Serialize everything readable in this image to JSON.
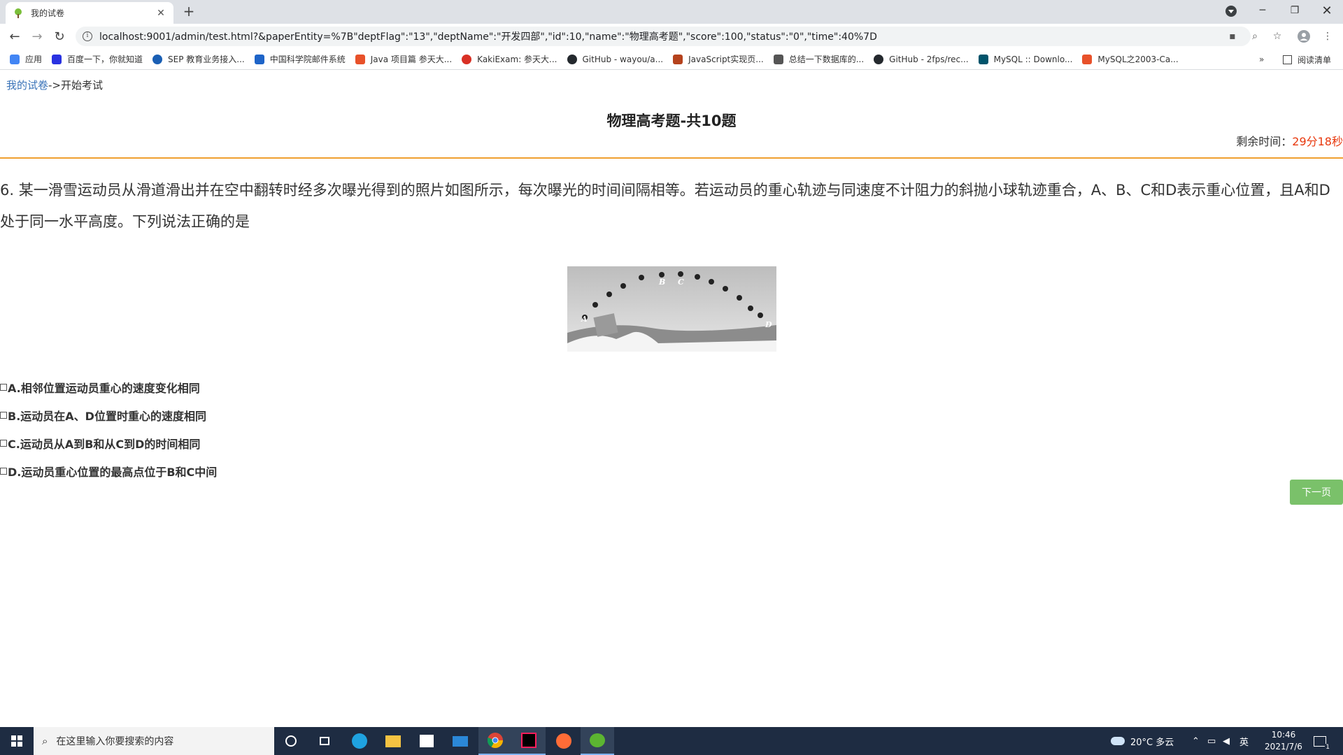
{
  "browser": {
    "tab_title": "我的试卷",
    "url": "localhost:9001/admin/test.html?&paperEntity=%7B\"deptFlag\":\"13\",\"deptName\":\"开发四部\",\"id\":10,\"name\":\"物理高考题\",\"score\":100,\"status\":\"0\",\"time\":40%7D",
    "bookmarks": [
      {
        "label": "应用",
        "color": "#4285f4"
      },
      {
        "label": "百度一下，你就知道",
        "color": "#2932e1"
      },
      {
        "label": "SEP 教育业务接入...",
        "color": "#1a5fb4"
      },
      {
        "label": "中国科学院邮件系统",
        "color": "#1e64c8"
      },
      {
        "label": "Java 项目篇 参天大...",
        "color": "#e8512a"
      },
      {
        "label": "KakiExam: 参天大...",
        "color": "#d93025"
      },
      {
        "label": "GitHub - wayou/a...",
        "color": "#24292e"
      },
      {
        "label": "JavaScript实现页...",
        "color": "#b5421d"
      },
      {
        "label": "总结一下数据库的...",
        "color": "#555555"
      },
      {
        "label": "GitHub - 2fps/rec...",
        "color": "#24292e"
      },
      {
        "label": "MySQL :: Downlo...",
        "color": "#00546b"
      },
      {
        "label": "MySQL之2003-Ca...",
        "color": "#e8512a"
      }
    ],
    "bookmarks_more": "»",
    "reading_list": "阅读清单"
  },
  "page": {
    "breadcrumb_link": "我的试卷",
    "breadcrumb_sep": "->",
    "breadcrumb_current": "开始考试",
    "paper_title": "物理高考题-共10题",
    "timer_label": "剩余时间：",
    "timer_value": "29分18秒",
    "question_text": "6. 某一滑雪运动员从滑道滑出并在空中翻转时经多次曝光得到的照片如图所示，每次曝光的时间间隔相等。若运动员的重心轨迹与同速度不计阻力的斜抛小球轨迹重合，A、B、C和D表示重心位置，且A和D处于同一水平高度。下列说法正确的是",
    "image_labels": [
      "A",
      "B",
      "C",
      "D"
    ],
    "options": [
      {
        "label": "A.相邻位置运动员重心的速度变化相同",
        "checked": false
      },
      {
        "label": "B.运动员在A、D位置时重心的速度相同",
        "checked": false
      },
      {
        "label": "C.运动员从A到B和从C到D的时间相同",
        "checked": false
      },
      {
        "label": "D.运动员重心位置的最高点位于B和C中间",
        "checked": false
      }
    ],
    "next_button": "下一页",
    "accent_color": "#f0a030",
    "timer_color": "#e8380d",
    "button_color": "#7ac16a"
  },
  "taskbar": {
    "search_placeholder": "在这里输入你要搜索的内容",
    "weather": "20°C  多云",
    "ime": "英",
    "time": "10:46",
    "date": "2021/7/6",
    "notification_count": "1"
  }
}
